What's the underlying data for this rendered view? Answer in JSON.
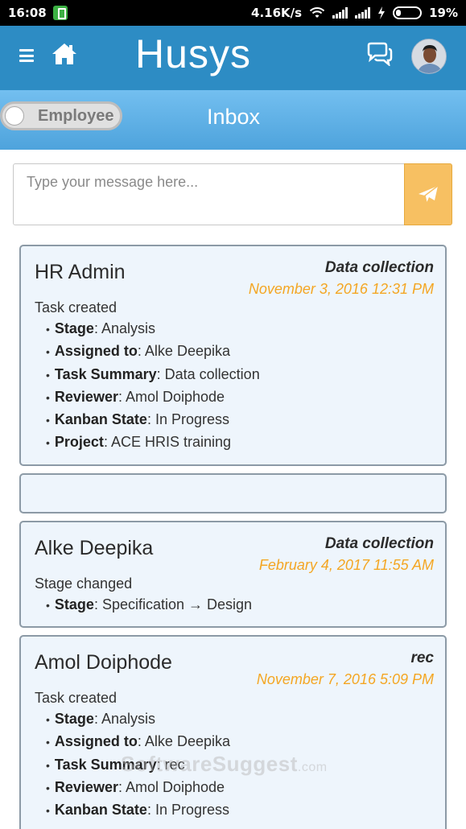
{
  "status_bar": {
    "time": "16:08",
    "network_speed": "4.16K/s",
    "battery": "19%",
    "icons": [
      "battery-saver-icon",
      "wifi-icon",
      "signal-icon",
      "signal-icon",
      "charging-icon",
      "battery-icon"
    ]
  },
  "header": {
    "title": "Husys",
    "menu_icon": "menu-icon",
    "home_icon": "home-icon",
    "chat_icon": "chat-icon"
  },
  "subheader": {
    "toggle_label": "Employee",
    "title": "Inbox"
  },
  "composer": {
    "placeholder": "Type your message here...",
    "send_icon": "send-icon",
    "colors": {
      "send_bg": "#f7c062"
    }
  },
  "feed": [
    {
      "author": "HR Admin",
      "topic": "Data collection",
      "timestamp": "November 3, 2016 12:31 PM",
      "action": "Task created",
      "details": [
        {
          "key": "Stage",
          "value": ": Analysis"
        },
        {
          "key": "Assigned to",
          "value": ": Alke Deepika"
        },
        {
          "key": "Task Summary",
          "value": ": Data collection"
        },
        {
          "key": "Reviewer",
          "value": ": Amol Doiphode"
        },
        {
          "key": "Kanban State",
          "value": ": In Progress"
        },
        {
          "key": "Project",
          "value": ": ACE HRIS training"
        }
      ]
    },
    {
      "author": "Alke Deepika",
      "topic": "Data collection",
      "timestamp": "February 4, 2017 11:55 AM",
      "action": "Stage changed",
      "details": [
        {
          "key": "Stage",
          "value": ": Specification → Design"
        }
      ]
    },
    {
      "author": "Amol Doiphode",
      "topic": "rec",
      "timestamp": "November 7, 2016 5:09 PM",
      "action": "Task created",
      "details": [
        {
          "key": "Stage",
          "value": ": Analysis"
        },
        {
          "key": "Assigned to",
          "value": ": Alke Deepika"
        },
        {
          "key": "Task Summary",
          "value": ": rec"
        },
        {
          "key": "Reviewer",
          "value": ": Amol Doiphode"
        },
        {
          "key": "Kanban State",
          "value": ": In Progress"
        }
      ]
    }
  ],
  "watermark": {
    "text": "SoftwareSuggest",
    "suffix": ".com"
  },
  "colors": {
    "header": "#2d8cc4",
    "subheader": "#5aaee4",
    "timestamp": "#f4a623",
    "card_bg": "#eef5fc"
  }
}
